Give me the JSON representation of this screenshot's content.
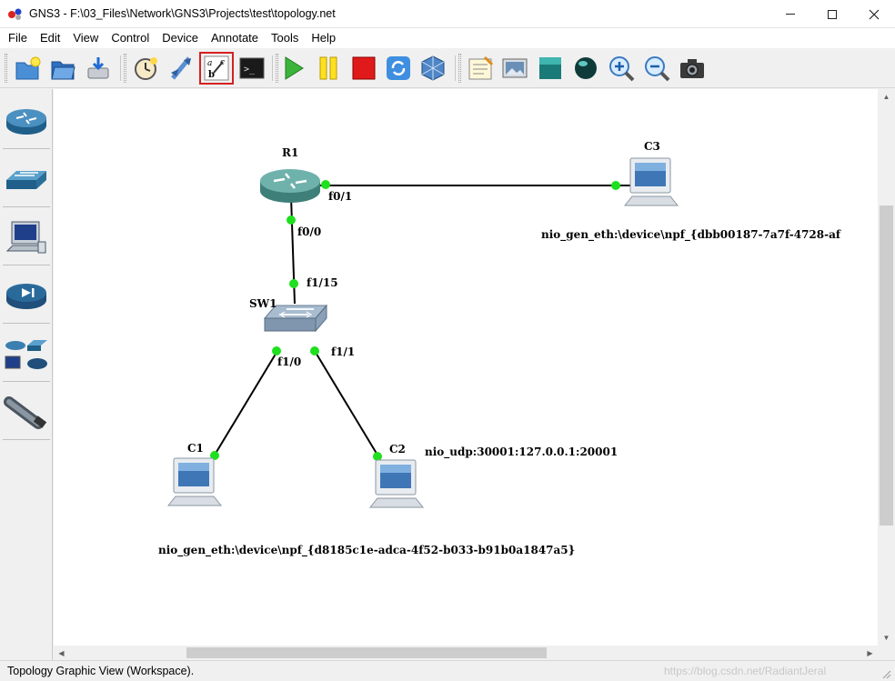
{
  "window": {
    "title": "GNS3 - F:\\03_Files\\Network\\GNS3\\Projects\\test\\topology.net"
  },
  "menu": [
    "File",
    "Edit",
    "View",
    "Control",
    "Device",
    "Annotate",
    "Tools",
    "Help"
  ],
  "toolbar": {
    "buttons": [
      {
        "name": "new-project-icon",
        "tooltip": "New blank project"
      },
      {
        "name": "open-project-icon",
        "tooltip": "Open a project"
      },
      {
        "name": "save-project-icon",
        "tooltip": "Save project"
      },
      {
        "name": "snapshot-icon",
        "tooltip": "Snapshot"
      },
      {
        "name": "add-link-icon",
        "tooltip": "Add a link"
      },
      {
        "name": "show-interface-labels-icon",
        "tooltip": "Show/Hide interface labels",
        "active": true
      },
      {
        "name": "console-icon",
        "tooltip": "Console connect to all devices"
      },
      {
        "name": "start-icon",
        "tooltip": "Start/Resume all devices"
      },
      {
        "name": "pause-icon",
        "tooltip": "Suspend all devices"
      },
      {
        "name": "stop-icon",
        "tooltip": "Stop all devices"
      },
      {
        "name": "reload-icon",
        "tooltip": "Reload all devices"
      },
      {
        "name": "virtualbox-icon",
        "tooltip": "VirtualBox"
      },
      {
        "name": "add-note-icon",
        "tooltip": "Add a note"
      },
      {
        "name": "insert-picture-icon",
        "tooltip": "Insert a picture"
      },
      {
        "name": "draw-rectangle-icon",
        "tooltip": "Draw a rectangle"
      },
      {
        "name": "draw-ellipse-icon",
        "tooltip": "Draw an ellipse"
      },
      {
        "name": "zoom-in-icon",
        "tooltip": "Zoom in"
      },
      {
        "name": "zoom-out-icon",
        "tooltip": "Zoom out"
      },
      {
        "name": "screenshot-icon",
        "tooltip": "Take a screenshot"
      }
    ]
  },
  "device_panel": [
    "router-device-icon",
    "switch-device-icon",
    "host-device-icon",
    "security-device-icon",
    "all-devices-icon",
    "cloud-device-icon"
  ],
  "topology": {
    "nodes": {
      "r1": "R1",
      "c3": "C3",
      "sw1": "SW1",
      "c1": "C1",
      "c2": "C2"
    },
    "interfaces": {
      "r1_f0_1": "f0/1",
      "r1_f0_0": "f0/0",
      "sw1_f1_15": "f1/15",
      "sw1_f1_0": "f1/0",
      "sw1_f1_1": "f1/1"
    },
    "notes": {
      "c3_nio": "nio_gen_eth:\\device\\npf_{dbb00187-7a7f-4728-af",
      "c2_nio": "nio_udp:30001:127.0.0.1:20001",
      "c1_nio": "nio_gen_eth:\\device\\npf_{d8185c1e-adca-4f52-b033-b91b0a1847a5}"
    },
    "link_endpoint_color": "#1ee01e"
  },
  "status": {
    "text": "Topology Graphic View (Workspace).",
    "watermark": "https://blog.csdn.net/RadiantJeral"
  }
}
